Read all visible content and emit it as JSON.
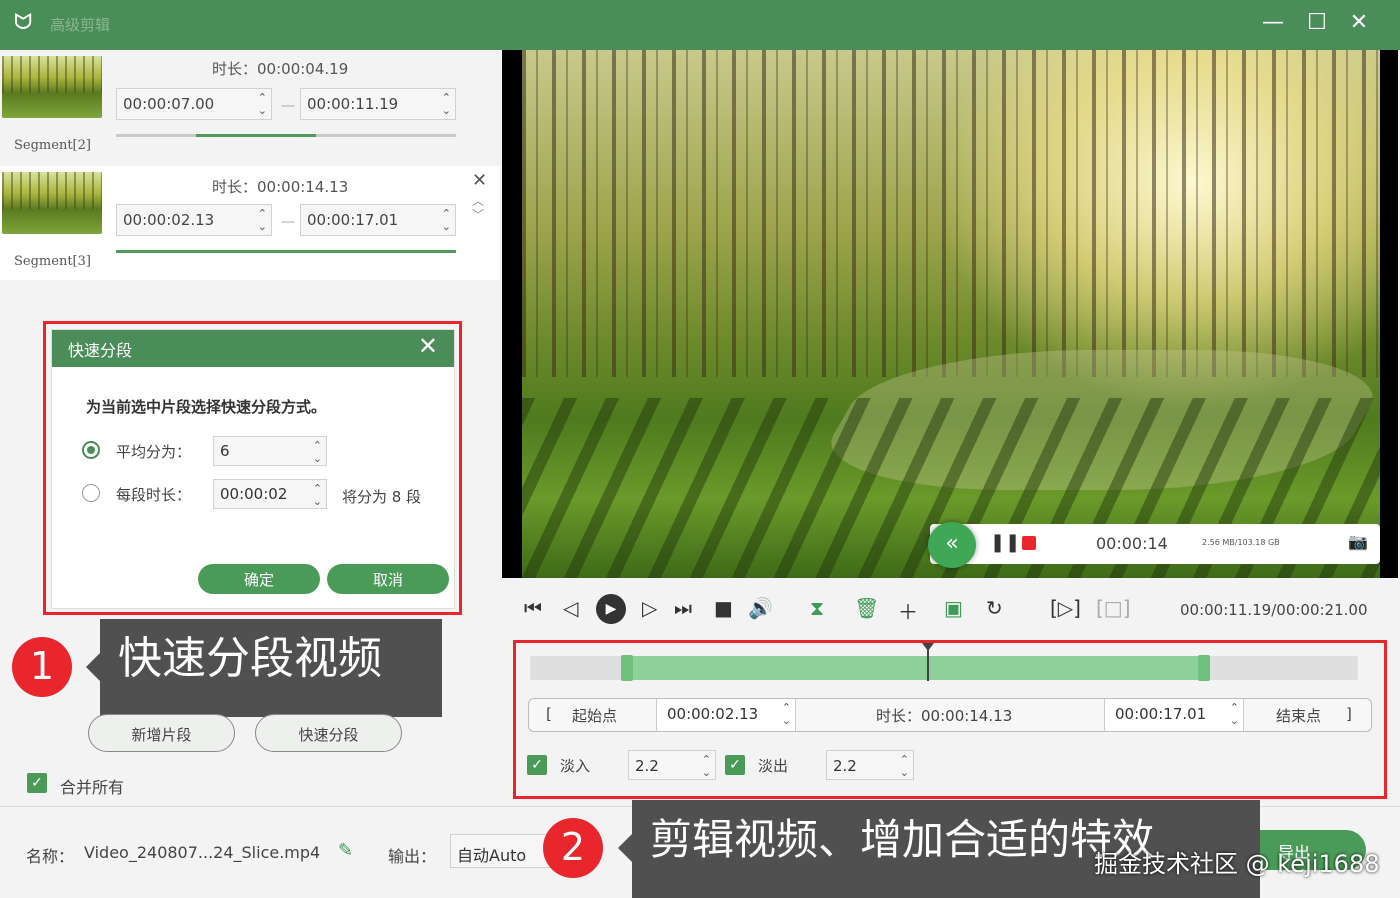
{
  "window": {
    "title": "高级剪辑",
    "minimize": "—",
    "maximize": "☐",
    "close": "✕"
  },
  "segments": [
    {
      "label": "Segment[2]",
      "duration_label": "时长：",
      "duration": "00:00:04.19",
      "start": "00:00:07.00",
      "end": "00:00:11.19"
    },
    {
      "label": "Segment[3]",
      "duration_label": "时长：",
      "duration": "00:00:14.13",
      "start": "00:00:02.13",
      "end": "00:00:17.01"
    }
  ],
  "dialog": {
    "title": "快速分段",
    "prompt": "为当前选中片段选择快速分段方式。",
    "option1_label": "平均分为：",
    "option1_value": "6",
    "option2_label": "每段时长：",
    "option2_value": "00:00:02",
    "option2_result": "将分为 8 段",
    "ok": "确定",
    "cancel": "取消"
  },
  "callouts": [
    {
      "number": "1",
      "text": "快速分段视频"
    },
    {
      "number": "2",
      "text": "剪辑视频、增加合适的特效"
    }
  ],
  "left_buttons": {
    "add_segment": "新增片段",
    "quick_split": "快速分段",
    "merge_all": "合并所有"
  },
  "bottom": {
    "name_label": "名称：",
    "name_value": "Video_240807...24_Slice.mp4",
    "output_label": "输出：",
    "output_value": "自动Auto",
    "export_button": "导出"
  },
  "player": {
    "time": "00:00:14",
    "size": "2.56 MB/103.18 GB"
  },
  "controls": {
    "timecode": "00:00:11.19/00:00:21.00"
  },
  "timeline": {
    "progress": 0.48,
    "start_label": "起始点",
    "start_value": "00:00:02.13",
    "duration_label": "时长：",
    "duration_value": "00:00:14.13",
    "end_value": "00:00:17.01",
    "end_label": "结束点",
    "fade_in_label": "淡入",
    "fade_in_value": "2.2",
    "fade_out_label": "淡出",
    "fade_out_value": "2.2"
  },
  "watermark": "掘金技术社区 @ keji1688"
}
